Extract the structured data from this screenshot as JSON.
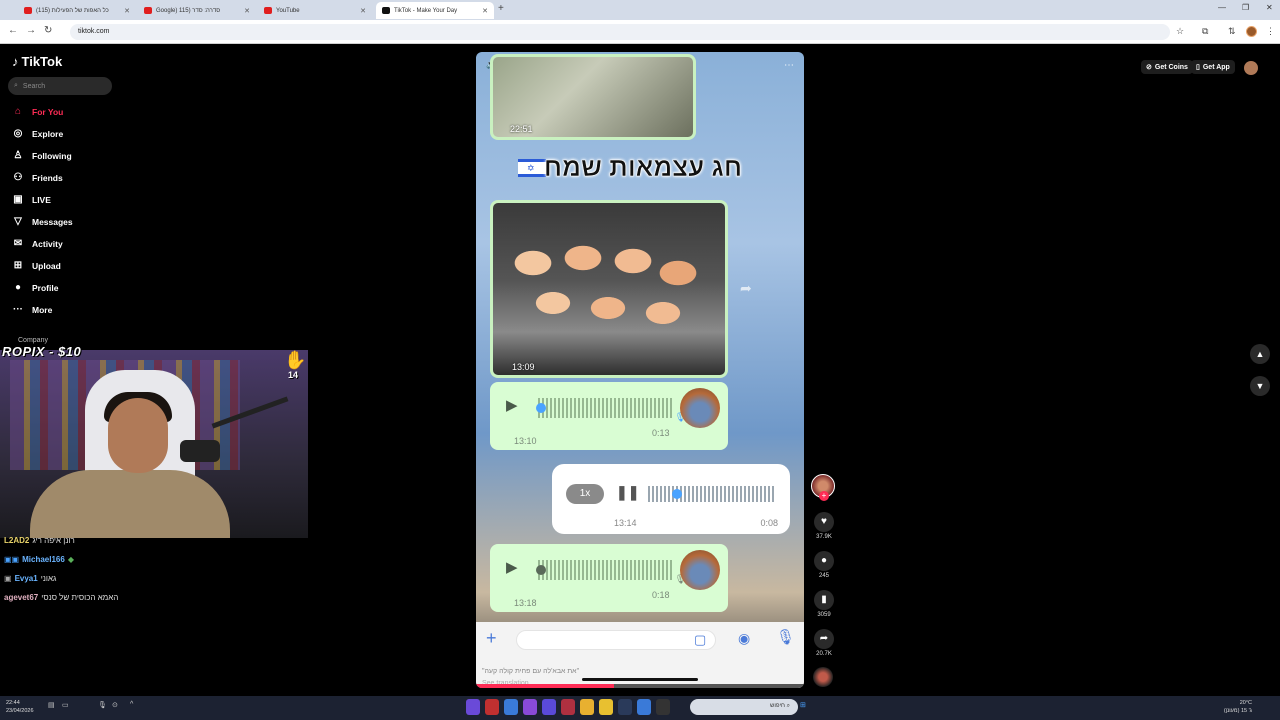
{
  "browser": {
    "tabs": [
      {
        "title": "כל האפות של הפעילות (115)"
      },
      {
        "title": "Google) 115) סדרה: סדר"
      },
      {
        "title": "YouTube"
      },
      {
        "title": "TikTok - Make Your Day"
      }
    ],
    "url": "tiktok.com"
  },
  "sidebar": {
    "logo": "TikTok",
    "search_placeholder": "Search",
    "items": [
      {
        "label": "For You",
        "icon": "home-icon",
        "active": true
      },
      {
        "label": "Explore",
        "icon": "compass-icon"
      },
      {
        "label": "Following",
        "icon": "following-icon"
      },
      {
        "label": "Friends",
        "icon": "friends-icon"
      },
      {
        "label": "LIVE",
        "icon": "live-icon"
      },
      {
        "label": "Messages",
        "icon": "messages-icon"
      },
      {
        "label": "Activity",
        "icon": "activity-icon"
      },
      {
        "label": "Upload",
        "icon": "upload-icon"
      },
      {
        "label": "Profile",
        "icon": "profile-avatar"
      },
      {
        "label": "More",
        "icon": "more-icon"
      }
    ],
    "company": "Company"
  },
  "stream_overlay": {
    "donation": "ROPIX - $10",
    "badge_count": "14",
    "chat": [
      {
        "user": "L2AD2",
        "message": "רונן איפה ריג",
        "color": "#e8d36a"
      },
      {
        "user": "Michael166",
        "message": "",
        "color": "#6ab4ff"
      },
      {
        "user": "Evya1",
        "message": "גאוני",
        "color": "#6ab4ff"
      },
      {
        "user": "agevet67",
        "message": "האמא הכוסית של סנסי",
        "color": "#e0b0c0"
      }
    ]
  },
  "video": {
    "timestamps": {
      "top_image": "22:51",
      "shrimp_image": "13:09",
      "voice1_time": "13:10",
      "voice1_duration": "0:13",
      "player_elapsed": "13:14",
      "player_duration": "0:08",
      "voice2_time": "13:18",
      "voice2_duration": "0:18"
    },
    "heading": "חג עצמאות שמח",
    "player_speed": "1x",
    "caption_title": "",
    "caption": "\"את אבא'לה עם פחית קולה קעה\"",
    "see_translation": "See translation",
    "progress_fraction": 0.42
  },
  "actions": {
    "likes": "37.9K",
    "comments": "245",
    "saves": "3059",
    "shares": "20.7K"
  },
  "topbar": {
    "get_coins": "Get Coins",
    "get_app": "Get App"
  },
  "taskbar": {
    "time": "22:44",
    "date": "23/04/2026",
    "search": "חיפוש",
    "weather_temp": "20°C",
    "weather_desc": "(מעונן) ג' 15"
  }
}
